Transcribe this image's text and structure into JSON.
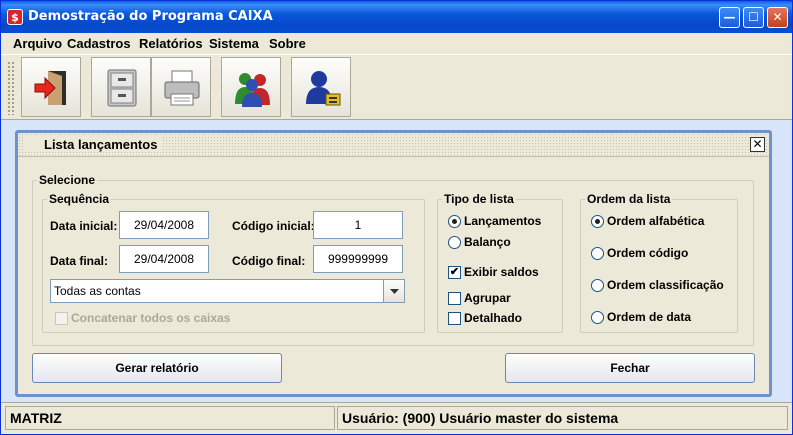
{
  "window": {
    "title": "Demostração do Programa CAIXA",
    "app_icon": "$"
  },
  "menu": [
    {
      "label": "Arquivo"
    },
    {
      "label": "Cadastros"
    },
    {
      "label": "Relatórios"
    },
    {
      "label": "Sistema"
    },
    {
      "label": "Sobre"
    }
  ],
  "toolbar": {
    "icons": [
      "exit-door-icon",
      "file-cabinet-icon",
      "printer-icon",
      "users-icon",
      "user-security-icon"
    ]
  },
  "frame": {
    "title": "Lista lançamentos"
  },
  "form": {
    "selecione_label": "Selecione",
    "sequencia_label": "Sequência",
    "data_inicial_label": "Data inicial:",
    "data_inicial_value": "29/04/2008",
    "data_final_label": "Data final:",
    "data_final_value": "29/04/2008",
    "codigo_inicial_label": "Código inicial:",
    "codigo_inicial_value": "1",
    "codigo_final_label": "Código final:",
    "codigo_final_value": "999999999",
    "contas_selected": "Todas as contas",
    "concatenar_label": "Concatenar todos os caixas",
    "concatenar_checked": false,
    "concatenar_enabled": false
  },
  "tipo_lista": {
    "label": "Tipo de lista",
    "options": [
      {
        "label": "Lançamentos",
        "selected": true
      },
      {
        "label": "Balanço",
        "selected": false
      }
    ],
    "exibir_saldos": {
      "label": "Exibir saldos",
      "checked": true
    },
    "agrupar": {
      "label": "Agrupar",
      "checked": false
    },
    "detalhado": {
      "label": "Detalhado",
      "checked": false
    }
  },
  "ordem_lista": {
    "label": "Ordem da lista",
    "options": [
      {
        "label": "Ordem alfabética",
        "selected": true
      },
      {
        "label": "Ordem código",
        "selected": false
      },
      {
        "label": "Ordem classificação",
        "selected": false
      },
      {
        "label": "Ordem de data",
        "selected": false
      }
    ]
  },
  "buttons": {
    "gerar": "Gerar relatório",
    "fechar": "Fechar"
  },
  "status": {
    "left": "MATRIZ",
    "right": "Usuário: (900) Usuário master do sistema"
  },
  "colors": {
    "titlebar": "#0a58dd",
    "frame_border": "#6f8fcf",
    "background": "#ece9d8"
  }
}
